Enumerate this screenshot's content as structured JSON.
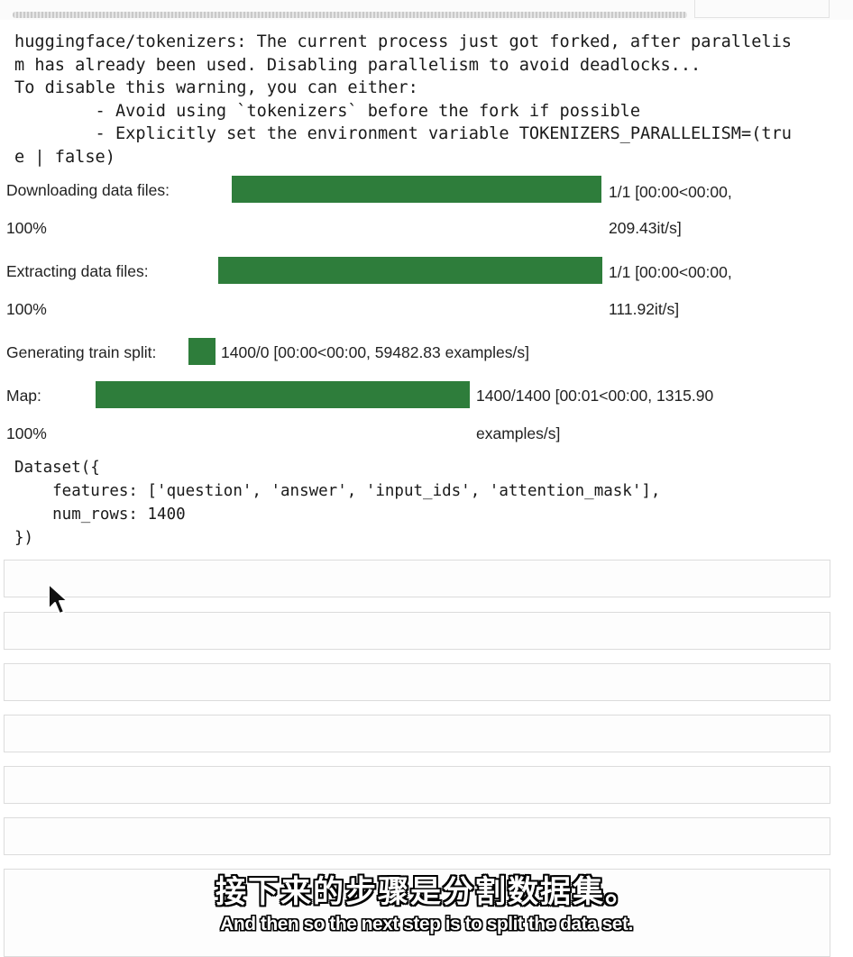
{
  "warning_lines": [
    "huggingface/tokenizers: The current process just got forked, after parallelis",
    "m has already been used. Disabling parallelism to avoid deadlocks...",
    "To disable this warning, you can either:",
    "        - Avoid using `tokenizers` before the fork if possible",
    "        - Explicitly set the environment variable TOKENIZERS_PARALLELISM=(tru",
    "e | false)"
  ],
  "progress": {
    "download": {
      "label": "Downloading data files:",
      "percent": "100%",
      "fill": 1.0,
      "stats_line1": "1/1 [00:00<00:00,",
      "stats_line2": "209.43it/s]"
    },
    "extract": {
      "label": "Extracting data files:",
      "percent": "100%",
      "fill": 1.0,
      "stats_line1": "1/1 [00:00<00:00,",
      "stats_line2": "111.92it/s]"
    },
    "generate": {
      "label": "Generating train split:",
      "fill": 1.0,
      "stats": "1400/0 [00:00<00:00, 59482.83 examples/s]"
    },
    "map": {
      "label": "Map:",
      "percent": "100%",
      "fill": 1.0,
      "stats_line1": "1400/1400 [00:01<00:00, 1315.90",
      "stats_line2": "examples/s]"
    }
  },
  "dataset_repr": [
    "Dataset({",
    "    features: ['question', 'answer', 'input_ids', 'attention_mask'],",
    "    num_rows: 1400",
    "})"
  ],
  "subtitles": {
    "zh": "接下来的步骤是分割数据集。",
    "en": "And then so the next step is to split the data set."
  },
  "colors": {
    "progress_fill": "#2e7d3b",
    "cell_border": "#dcdcdc"
  },
  "icons": {
    "cursor": "mouse-pointer-icon"
  }
}
